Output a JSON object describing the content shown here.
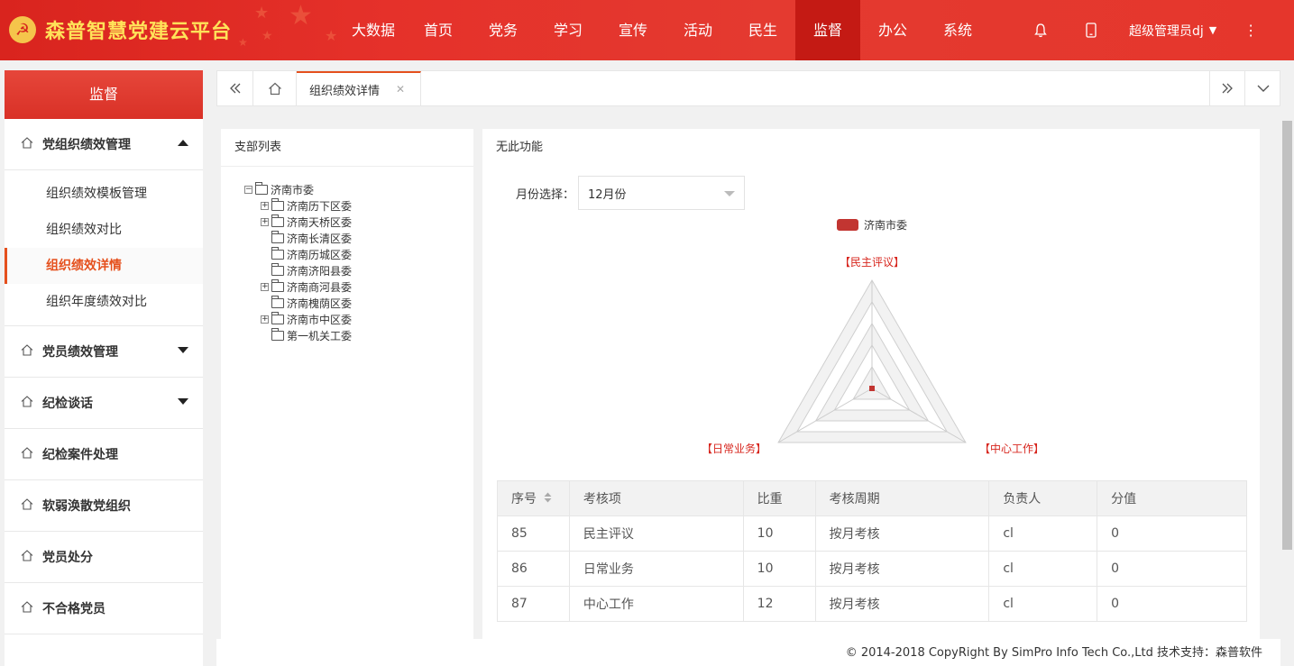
{
  "app": {
    "title": "森普智慧党建云平台",
    "emblem": "☭"
  },
  "nav": [
    "大数据",
    "首页",
    "党务",
    "学习",
    "宣传",
    "活动",
    "民生",
    "监督",
    "办公",
    "系统"
  ],
  "nav_active": "监督",
  "user": {
    "name": "超级管理员dj"
  },
  "sidebar": {
    "header": "监督",
    "groups": [
      {
        "label": "党组织绩效管理",
        "expanded": true,
        "items": [
          "组织绩效模板管理",
          "组织绩效对比",
          "组织绩效详情",
          "组织年度绩效对比"
        ],
        "active": "组织绩效详情"
      },
      {
        "label": "党员绩效管理"
      },
      {
        "label": "纪检谈话"
      },
      {
        "label": "纪检案件处理"
      },
      {
        "label": "软弱涣散党组织"
      },
      {
        "label": "党员处分"
      },
      {
        "label": "不合格党员"
      }
    ]
  },
  "tabs": {
    "active_tab": "组织绩效详情"
  },
  "left_panel": {
    "title": "支部列表",
    "tree_root": "济南市委",
    "tree_children": [
      {
        "label": "济南历下区委",
        "expandable": true
      },
      {
        "label": "济南天桥区委",
        "expandable": true
      },
      {
        "label": "济南长清区委",
        "expandable": false
      },
      {
        "label": "济南历城区委",
        "expandable": false
      },
      {
        "label": "济南济阳县委",
        "expandable": false
      },
      {
        "label": "济南商河县委",
        "expandable": true
      },
      {
        "label": "济南槐荫区委",
        "expandable": false
      },
      {
        "label": "济南市中区委",
        "expandable": true
      },
      {
        "label": "第一机关工委",
        "expandable": false
      }
    ]
  },
  "right_panel": {
    "title": "无此功能",
    "month_label": "月份选择：",
    "month_value": "12月份"
  },
  "chart_data": {
    "type": "radar",
    "legend": [
      "济南市委"
    ],
    "legend_color": "#c23531",
    "indicators": [
      "【民主评议】",
      "【中心工作】",
      "【日常业务】"
    ],
    "series": [
      {
        "name": "济南市委",
        "values": [
          0,
          0,
          0
        ]
      }
    ]
  },
  "table": {
    "headers": [
      "序号",
      "考核项",
      "比重",
      "考核周期",
      "负责人",
      "分值"
    ],
    "rows": [
      [
        "85",
        "民主评议",
        "10",
        "按月考核",
        "cl",
        "0"
      ],
      [
        "86",
        "日常业务",
        "10",
        "按月考核",
        "cl",
        "0"
      ],
      [
        "87",
        "中心工作",
        "12",
        "按月考核",
        "cl",
        "0"
      ]
    ]
  },
  "footer": "© 2014-2018 CopyRight By SimPro Info Tech Co.,Ltd 技术支持：森普软件"
}
